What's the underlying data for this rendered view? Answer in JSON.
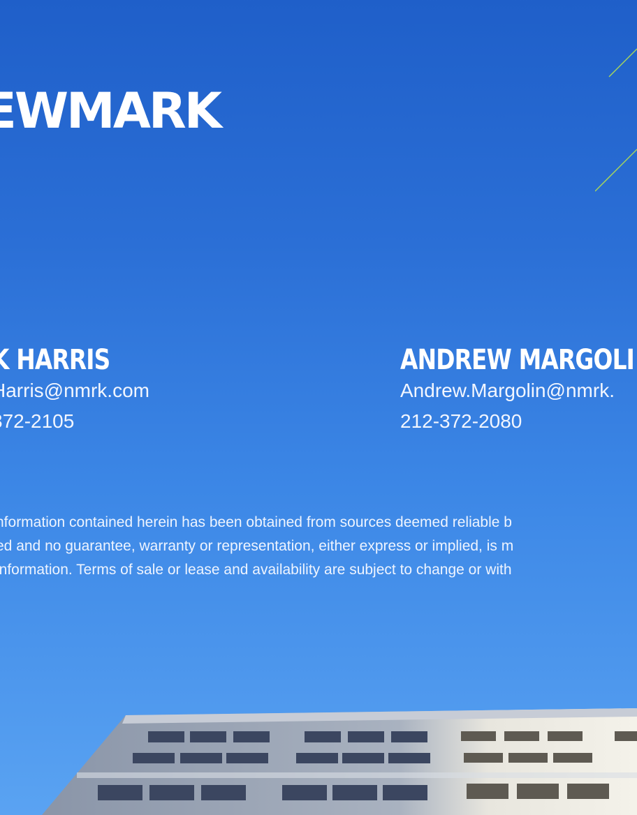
{
  "brand": {
    "logo_text": "EWMARK"
  },
  "contacts": [
    {
      "name": "K HARRIS",
      "email": "Harris@nmrk.com",
      "phone": "372-2105"
    },
    {
      "name": "ANDREW MARGOLI",
      "email": "Andrew.Margolin@nmrk.",
      "phone": "212-372-2080"
    }
  ],
  "disclaimer": {
    "lines": [
      "nformation contained herein has been obtained from sources deemed reliable b",
      "ed and no guarantee, warranty or representation, either express or implied, is m",
      "information. Terms of sale or lease and availability are subject to change or with"
    ]
  },
  "colors": {
    "sky_top": "#1f5fc9",
    "sky_bottom": "#5aa3f2",
    "accent_line": "#a8d65a",
    "text": "#ffffff"
  }
}
